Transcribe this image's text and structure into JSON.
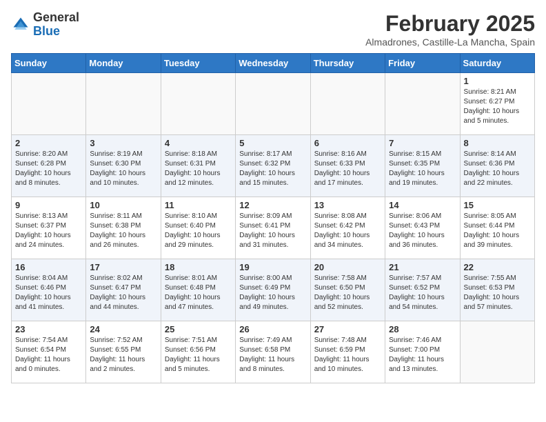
{
  "header": {
    "logo_general": "General",
    "logo_blue": "Blue",
    "month_title": "February 2025",
    "subtitle": "Almadrones, Castille-La Mancha, Spain"
  },
  "days_of_week": [
    "Sunday",
    "Monday",
    "Tuesday",
    "Wednesday",
    "Thursday",
    "Friday",
    "Saturday"
  ],
  "weeks": [
    [
      {
        "day": "",
        "info": ""
      },
      {
        "day": "",
        "info": ""
      },
      {
        "day": "",
        "info": ""
      },
      {
        "day": "",
        "info": ""
      },
      {
        "day": "",
        "info": ""
      },
      {
        "day": "",
        "info": ""
      },
      {
        "day": "1",
        "info": "Sunrise: 8:21 AM\nSunset: 6:27 PM\nDaylight: 10 hours and 5 minutes."
      }
    ],
    [
      {
        "day": "2",
        "info": "Sunrise: 8:20 AM\nSunset: 6:28 PM\nDaylight: 10 hours and 8 minutes."
      },
      {
        "day": "3",
        "info": "Sunrise: 8:19 AM\nSunset: 6:30 PM\nDaylight: 10 hours and 10 minutes."
      },
      {
        "day": "4",
        "info": "Sunrise: 8:18 AM\nSunset: 6:31 PM\nDaylight: 10 hours and 12 minutes."
      },
      {
        "day": "5",
        "info": "Sunrise: 8:17 AM\nSunset: 6:32 PM\nDaylight: 10 hours and 15 minutes."
      },
      {
        "day": "6",
        "info": "Sunrise: 8:16 AM\nSunset: 6:33 PM\nDaylight: 10 hours and 17 minutes."
      },
      {
        "day": "7",
        "info": "Sunrise: 8:15 AM\nSunset: 6:35 PM\nDaylight: 10 hours and 19 minutes."
      },
      {
        "day": "8",
        "info": "Sunrise: 8:14 AM\nSunset: 6:36 PM\nDaylight: 10 hours and 22 minutes."
      }
    ],
    [
      {
        "day": "9",
        "info": "Sunrise: 8:13 AM\nSunset: 6:37 PM\nDaylight: 10 hours and 24 minutes."
      },
      {
        "day": "10",
        "info": "Sunrise: 8:11 AM\nSunset: 6:38 PM\nDaylight: 10 hours and 26 minutes."
      },
      {
        "day": "11",
        "info": "Sunrise: 8:10 AM\nSunset: 6:40 PM\nDaylight: 10 hours and 29 minutes."
      },
      {
        "day": "12",
        "info": "Sunrise: 8:09 AM\nSunset: 6:41 PM\nDaylight: 10 hours and 31 minutes."
      },
      {
        "day": "13",
        "info": "Sunrise: 8:08 AM\nSunset: 6:42 PM\nDaylight: 10 hours and 34 minutes."
      },
      {
        "day": "14",
        "info": "Sunrise: 8:06 AM\nSunset: 6:43 PM\nDaylight: 10 hours and 36 minutes."
      },
      {
        "day": "15",
        "info": "Sunrise: 8:05 AM\nSunset: 6:44 PM\nDaylight: 10 hours and 39 minutes."
      }
    ],
    [
      {
        "day": "16",
        "info": "Sunrise: 8:04 AM\nSunset: 6:46 PM\nDaylight: 10 hours and 41 minutes."
      },
      {
        "day": "17",
        "info": "Sunrise: 8:02 AM\nSunset: 6:47 PM\nDaylight: 10 hours and 44 minutes."
      },
      {
        "day": "18",
        "info": "Sunrise: 8:01 AM\nSunset: 6:48 PM\nDaylight: 10 hours and 47 minutes."
      },
      {
        "day": "19",
        "info": "Sunrise: 8:00 AM\nSunset: 6:49 PM\nDaylight: 10 hours and 49 minutes."
      },
      {
        "day": "20",
        "info": "Sunrise: 7:58 AM\nSunset: 6:50 PM\nDaylight: 10 hours and 52 minutes."
      },
      {
        "day": "21",
        "info": "Sunrise: 7:57 AM\nSunset: 6:52 PM\nDaylight: 10 hours and 54 minutes."
      },
      {
        "day": "22",
        "info": "Sunrise: 7:55 AM\nSunset: 6:53 PM\nDaylight: 10 hours and 57 minutes."
      }
    ],
    [
      {
        "day": "23",
        "info": "Sunrise: 7:54 AM\nSunset: 6:54 PM\nDaylight: 11 hours and 0 minutes."
      },
      {
        "day": "24",
        "info": "Sunrise: 7:52 AM\nSunset: 6:55 PM\nDaylight: 11 hours and 2 minutes."
      },
      {
        "day": "25",
        "info": "Sunrise: 7:51 AM\nSunset: 6:56 PM\nDaylight: 11 hours and 5 minutes."
      },
      {
        "day": "26",
        "info": "Sunrise: 7:49 AM\nSunset: 6:58 PM\nDaylight: 11 hours and 8 minutes."
      },
      {
        "day": "27",
        "info": "Sunrise: 7:48 AM\nSunset: 6:59 PM\nDaylight: 11 hours and 10 minutes."
      },
      {
        "day": "28",
        "info": "Sunrise: 7:46 AM\nSunset: 7:00 PM\nDaylight: 11 hours and 13 minutes."
      },
      {
        "day": "",
        "info": ""
      }
    ]
  ]
}
